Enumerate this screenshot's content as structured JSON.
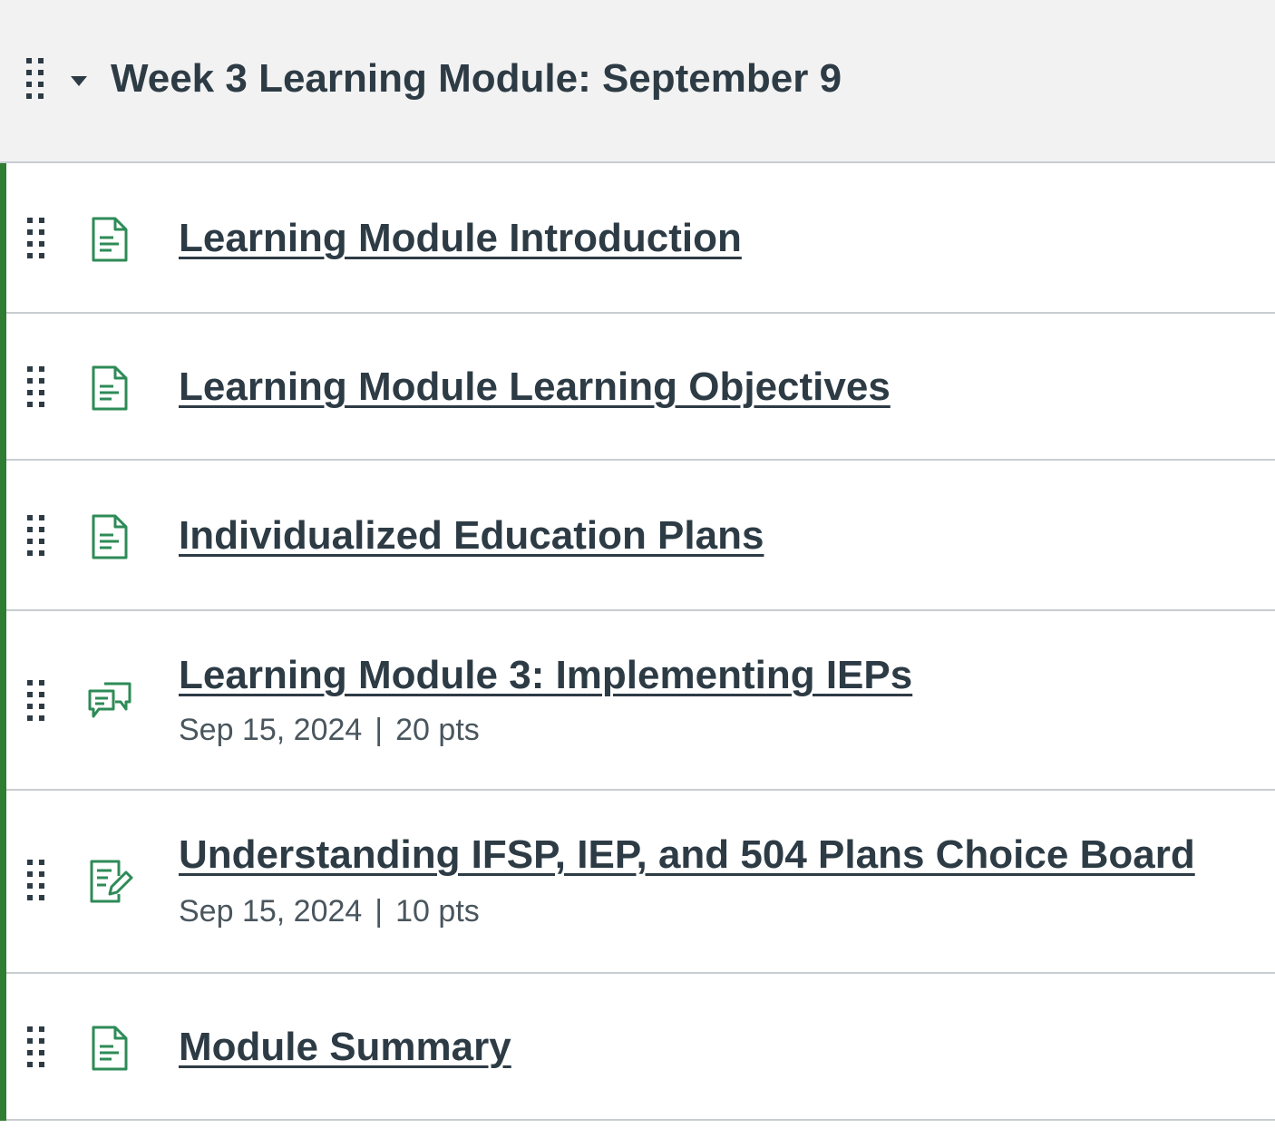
{
  "module": {
    "title": "Week 3 Learning Module: September 9",
    "accent_color": "#2e7d32",
    "icon_color": "#2e8b57",
    "items": [
      {
        "title": "Learning Module Introduction",
        "icon": "page-icon"
      },
      {
        "title": "Learning Module Learning Objectives",
        "icon": "page-icon"
      },
      {
        "title": "Individualized Education Plans",
        "icon": "page-icon"
      },
      {
        "title": "Learning Module 3: Implementing IEPs",
        "icon": "discussion-icon",
        "due": "Sep 15, 2024",
        "separator": "|",
        "points": "20 pts"
      },
      {
        "title": "Understanding IFSP, IEP, and 504 Plans Choice Board",
        "icon": "assignment-icon",
        "due": "Sep 15, 2024",
        "separator": "|",
        "points": "10 pts"
      },
      {
        "title": "Module Summary",
        "icon": "page-icon"
      }
    ]
  }
}
